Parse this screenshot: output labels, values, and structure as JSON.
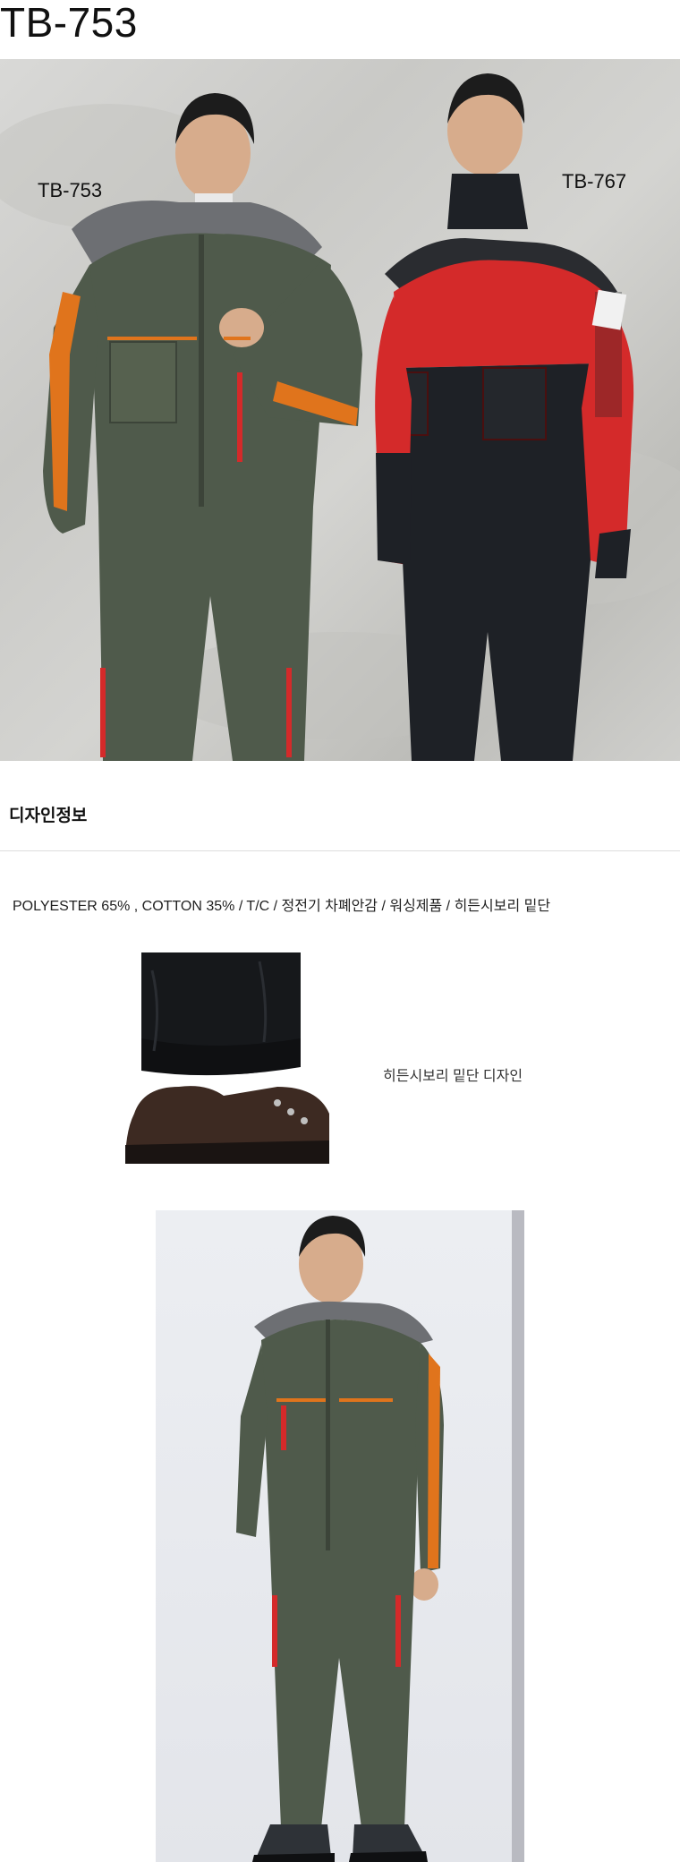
{
  "page": {
    "title": "TB-753"
  },
  "hero": {
    "left_model_label": "TB-753",
    "right_model_label": "TB-767"
  },
  "design_info": {
    "heading": "디자인정보",
    "spec": "POLYESTER 65% , COTTON 35%  / T/C /  정전기 차폐안감 / 워싱제품 / 히든시보리 밑단"
  },
  "detail": {
    "caption": "히든시보리 밑단 디자인"
  },
  "colors": {
    "olive": "#4f5a4b",
    "orange": "#e0741c",
    "red": "#d42a2a",
    "black": "#1e2126",
    "gray_hood": "#6d6f73"
  }
}
